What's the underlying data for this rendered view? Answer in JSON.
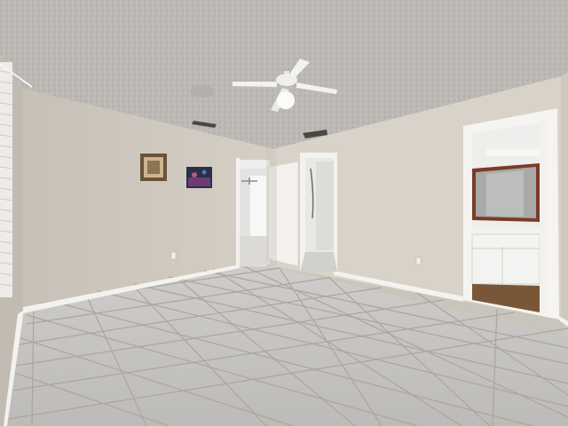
{
  "scene": {
    "kind": "empty-bedroom-interior",
    "colors": {
      "ceiling": "#bdbab6",
      "wall_left": "#d4cdc3",
      "wall_back": "#d9d2c8",
      "wall_right": "#ddd6cc",
      "floor_tile": "#c8c6c2",
      "grout": "#a9a6a1",
      "trim": "#f4f2ee",
      "door": "#f3f2ef",
      "bath_floor": "#7a5638",
      "mirror_frame": "#7a3b28"
    }
  }
}
